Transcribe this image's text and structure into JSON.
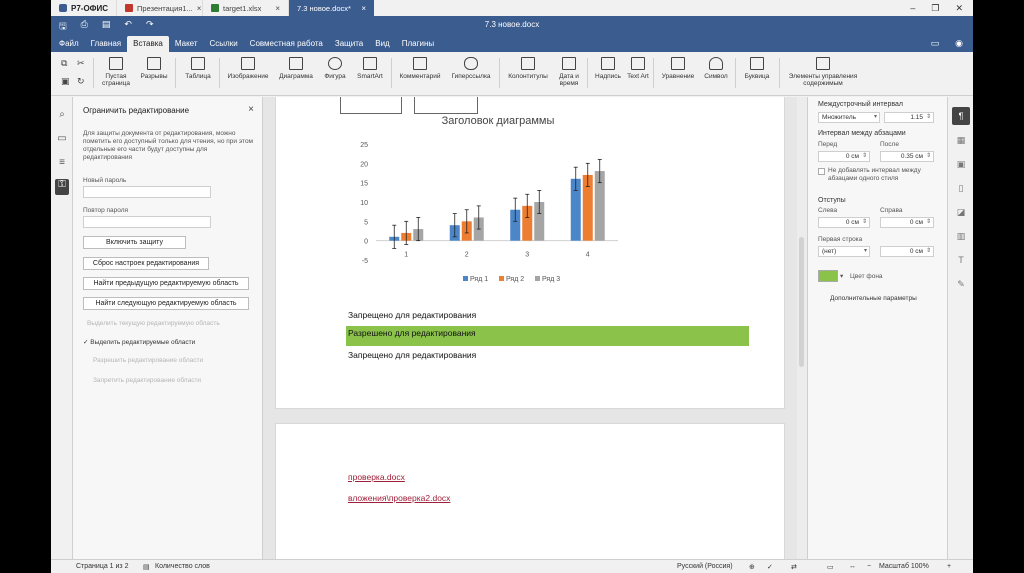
{
  "tabbar": {
    "brand": "Р7-ОФИС",
    "tabs": [
      {
        "label": "Презентация1...",
        "color": "#c0392b",
        "active": false
      },
      {
        "label": "target1.xlsx",
        "color": "#2e7d32",
        "active": false
      },
      {
        "label": "7.3 новое.docx*",
        "color": "#3b5c8f",
        "active": true
      }
    ]
  },
  "title": "7.3 новое.docx",
  "menu": {
    "items": [
      "Файл",
      "Главная",
      "Вставка",
      "Макет",
      "Ссылки",
      "Совместная работа",
      "Защита",
      "Вид",
      "Плагины"
    ],
    "active": "Вставка"
  },
  "toolbar": {
    "blank_page": "Пустая страница",
    "breaks": "Разрывы",
    "table": "Таблица",
    "image": "Изображение",
    "chart": "Диаграмма",
    "shape": "Фигура",
    "smartart": "SmartArt",
    "comment": "Комментарий",
    "hyperlink": "Гиперссылка",
    "header_footer": "Колонтитулы",
    "date_time": "Дата и время",
    "text_box": "Надпись",
    "text_art": "Text Art",
    "equation": "Уравнение",
    "symbol": "Символ",
    "drop_cap": "Буквица",
    "content_controls": "Элементы управления содержимым"
  },
  "left_panel": {
    "title": "Ограничить редактирование",
    "description": "Для защиты документа от редактирования, можно пометить его доступный только для чтения, но при этом отдельные его части будут доступны для редактирования",
    "new_password_label": "Новый пароль",
    "repeat_password_label": "Повтор пароля",
    "enable_protection": "Включить защиту",
    "reset_settings": "Сброс настроек редактирования",
    "find_previous": "Найти предыдущую редактируемую область",
    "find_next": "Найти следующую редактируемую область",
    "highlight_all": "Выделить текущую редактируемую область",
    "highlight_editable": "Выделить редактируемые области",
    "allow_editing": "Разрешить редактирование области",
    "forbid_editing": "Запретить редактирование области"
  },
  "document": {
    "chart_lines": [
      {
        "text": "Запрещено для редактирования",
        "highlight": false
      },
      {
        "text": "Разрешено для редактирования",
        "highlight": true
      },
      {
        "text": "Запрещено для редактирования",
        "highlight": false
      }
    ],
    "highlight_color": "#8bc34a",
    "links": [
      "проверка.docx",
      "вложения\\проверка2.docx"
    ]
  },
  "chart_data": {
    "type": "bar",
    "title": "Заголовок диаграммы",
    "categories": [
      "1",
      "2",
      "3",
      "4"
    ],
    "series": [
      {
        "name": "Ряд 1",
        "color": "#4a86c8",
        "values": [
          1,
          4,
          8,
          16
        ],
        "error": [
          3,
          3,
          3,
          3
        ]
      },
      {
        "name": "Ряд 2",
        "color": "#ed7d31",
        "values": [
          2,
          5,
          9,
          17
        ],
        "error": [
          3,
          3,
          3,
          3
        ]
      },
      {
        "name": "Ряд 3",
        "color": "#a5a5a5",
        "values": [
          3,
          6,
          10,
          18
        ],
        "error": [
          3,
          3,
          3,
          3
        ]
      }
    ],
    "yticks": [
      "25",
      "20",
      "15",
      "10",
      "5",
      "0",
      "-5"
    ],
    "ylim": [
      -5,
      25
    ],
    "legend": "bottom"
  },
  "right_panel": {
    "line_spacing_label": "Междустрочный интервал",
    "line_spacing_mode": "Множитель",
    "line_spacing_value": "1.15",
    "para_spacing_label": "Интервал между абзацами",
    "before_label": "Перед",
    "after_label": "После",
    "before_value": "0 см",
    "after_value": "0.35 см",
    "no_spacing_same_style": "Не добавлять интервал между абзацами одного стиля",
    "indents_label": "Отступы",
    "left_label": "Слева",
    "right_label": "Справа",
    "left_value": "0 см",
    "right_value": "0 см",
    "first_line_label": "Первая строка",
    "first_line_mode": "(нет)",
    "first_line_value": "0 см",
    "bg_color_label": "Цвет фона",
    "bg_color": "#8bc34a",
    "advanced_settings": "Дополнительные параметры"
  },
  "status": {
    "page": "Страница 1 из 2",
    "word_count": "Количество слов",
    "language": "Русский (Россия)",
    "zoom": "Масштаб 100%"
  }
}
